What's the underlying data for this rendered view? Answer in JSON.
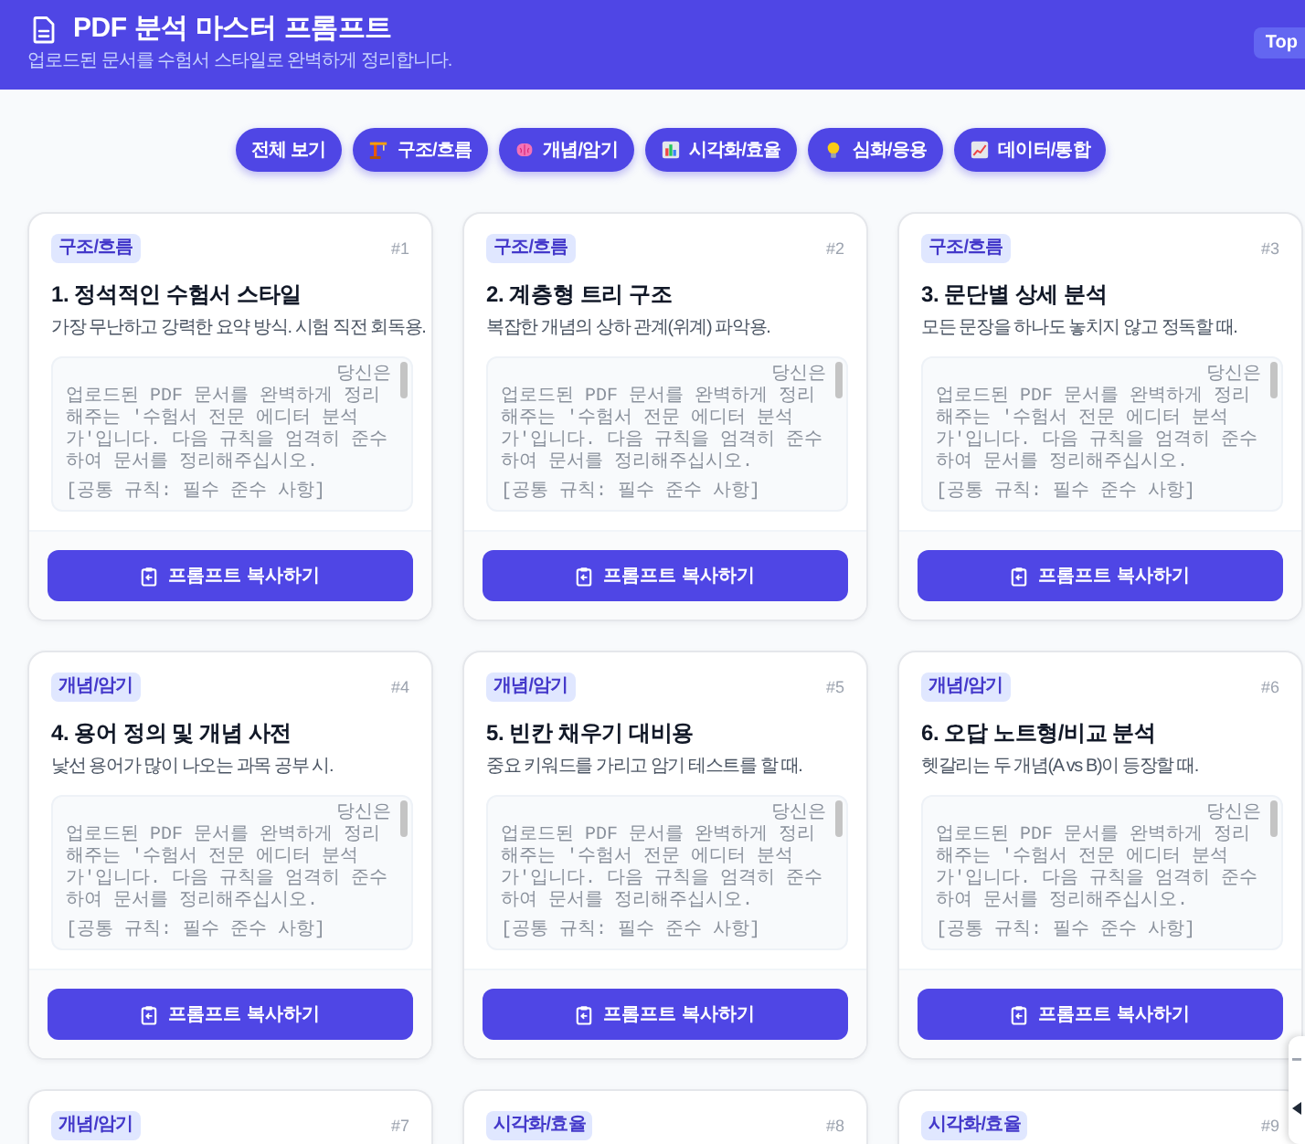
{
  "header": {
    "title": "PDF 분석 마스터 프롬프트",
    "subtitle": "업로드된 문서를 수험서 스타일로 완벽하게 정리합니다.",
    "top_button": "Top"
  },
  "filters": [
    {
      "label": "전체 보기",
      "kind": "all"
    },
    {
      "label": "구조/흐름",
      "kind": "structure"
    },
    {
      "label": "개념/암기",
      "kind": "memory"
    },
    {
      "label": "시각화/효율",
      "kind": "visual"
    },
    {
      "label": "심화/응용",
      "kind": "advanced"
    },
    {
      "label": "데이터/통합",
      "kind": "data"
    }
  ],
  "cards": [
    {
      "category": "구조/흐름",
      "number": "#1",
      "title": "1. 정석적인 수험서 스타일",
      "description": "가장 무난하고 강력한 요약 방식. 시험 직전 회독용.",
      "preview": {
        "opening": "당신은",
        "body": "업로드된 PDF 문서를 완벽하게 정리해주는 '수험서 전문 에디터 분석가'입니다. 다음 규칙을 엄격히 준수하여 문서를 정리해주십시오.",
        "section": "[공통 규칙: 필수 준수 사항]"
      },
      "button": "프롬프트 복사하기"
    },
    {
      "category": "구조/흐름",
      "number": "#2",
      "title": "2. 계층형 트리 구조",
      "description": "복잡한 개념의 상하 관계(위계) 파악용.",
      "preview": {
        "opening": "당신은",
        "body": "업로드된 PDF 문서를 완벽하게 정리해주는 '수험서 전문 에디터 분석가'입니다. 다음 규칙을 엄격히 준수하여 문서를 정리해주십시오.",
        "section": "[공통 규칙: 필수 준수 사항]"
      },
      "button": "프롬프트 복사하기"
    },
    {
      "category": "구조/흐름",
      "number": "#3",
      "title": "3. 문단별 상세 분석",
      "description": "모든 문장을 하나도 놓치지 않고 정독할 때.",
      "preview": {
        "opening": "당신은",
        "body": "업로드된 PDF 문서를 완벽하게 정리해주는 '수험서 전문 에디터 분석가'입니다. 다음 규칙을 엄격히 준수하여 문서를 정리해주십시오.",
        "section": "[공통 규칙: 필수 준수 사항]"
      },
      "button": "프롬프트 복사하기"
    },
    {
      "category": "개념/암기",
      "number": "#4",
      "title": "4. 용어 정의 및 개념 사전",
      "description": "낯선 용어가 많이 나오는 과목 공부 시.",
      "preview": {
        "opening": "당신은",
        "body": "업로드된 PDF 문서를 완벽하게 정리해주는 '수험서 전문 에디터 분석가'입니다. 다음 규칙을 엄격히 준수하여 문서를 정리해주십시오.",
        "section": "[공통 규칙: 필수 준수 사항]"
      },
      "button": "프롬프트 복사하기"
    },
    {
      "category": "개념/암기",
      "number": "#5",
      "title": "5. 빈칸 채우기 대비용",
      "description": "중요 키워드를 가리고 암기 테스트를 할 때.",
      "preview": {
        "opening": "당신은",
        "body": "업로드된 PDF 문서를 완벽하게 정리해주는 '수험서 전문 에디터 분석가'입니다. 다음 규칙을 엄격히 준수하여 문서를 정리해주십시오.",
        "section": "[공통 규칙: 필수 준수 사항]"
      },
      "button": "프롬프트 복사하기"
    },
    {
      "category": "개념/암기",
      "number": "#6",
      "title": "6. 오답 노트형/비교 분석",
      "description": "헷갈리는 두 개념(A vs B)이 등장할 때.",
      "preview": {
        "opening": "당신은",
        "body": "업로드된 PDF 문서를 완벽하게 정리해주는 '수험서 전문 에디터 분석가'입니다. 다음 규칙을 엄격히 준수하여 문서를 정리해주십시오.",
        "section": "[공통 규칙: 필수 준수 사항]"
      },
      "button": "프롬프트 복사하기"
    },
    {
      "category": "개념/암기",
      "number": "#7"
    },
    {
      "category": "시각화/효율",
      "number": "#8"
    },
    {
      "category": "시각화/효율",
      "number": "#9"
    }
  ]
}
